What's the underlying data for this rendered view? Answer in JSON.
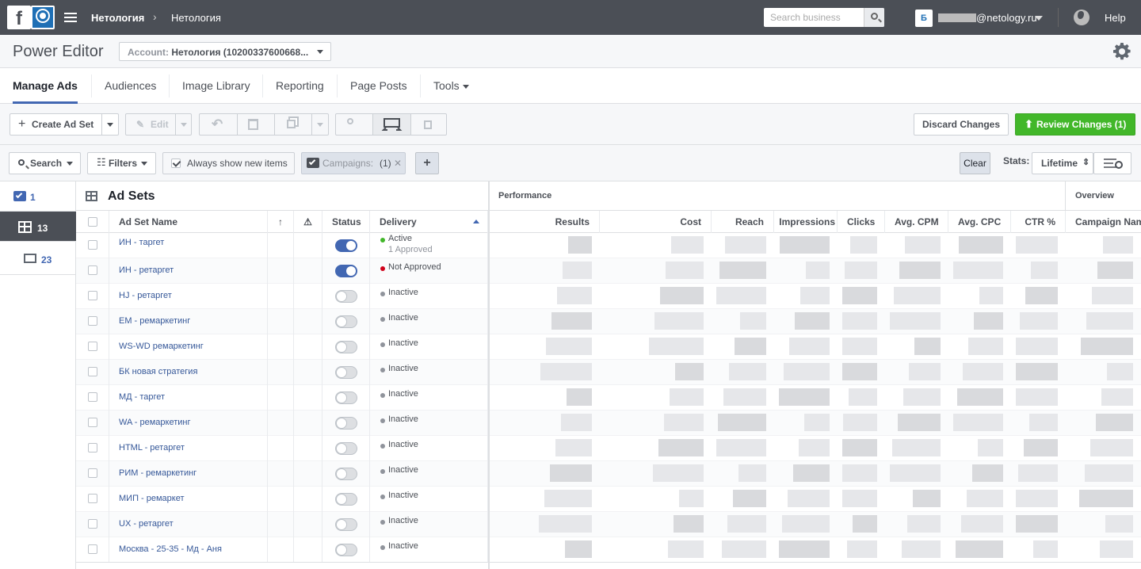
{
  "header": {
    "fb_logo_glyph": "f",
    "breadcrumb": [
      "Нетология",
      "Нетология"
    ],
    "search_placeholder": "Search business",
    "account_initial": "Б",
    "email": "@netology.ru",
    "help": "Help"
  },
  "title_bar": {
    "title": "Power Editor",
    "account_label": "Account:",
    "account_value": "Нетология (10200337600668..."
  },
  "tabs": [
    {
      "label": "Manage Ads",
      "active": true
    },
    {
      "label": "Audiences"
    },
    {
      "label": "Image Library"
    },
    {
      "label": "Reporting"
    },
    {
      "label": "Page Posts"
    },
    {
      "label": "Tools"
    }
  ],
  "toolbar": {
    "create_label": "Create Ad Set",
    "edit_label": "Edit",
    "discard_label": "Discard Changes",
    "review_label": "Review Changes (1)"
  },
  "filterbar": {
    "search_label": "Search",
    "filters_label": "Filters",
    "always_show_label": "Always show new items",
    "campaigns_label": "Campaigns:",
    "campaigns_count": "(1)",
    "clear_label": "Clear",
    "stats_label": "Stats:",
    "stats_value": "Lifetime"
  },
  "levels": [
    {
      "count": "1"
    },
    {
      "count": "13"
    },
    {
      "count": "23"
    }
  ],
  "grid": {
    "title": "Ad Sets",
    "performance_label": "Performance",
    "overview_label": "Overview",
    "columns": {
      "name": "Ad Set Name",
      "status": "Status",
      "delivery": "Delivery",
      "results": "Results",
      "cost": "Cost",
      "reach": "Reach",
      "impressions": "Impressions",
      "clicks": "Clicks",
      "avg_cpm": "Avg. CPM",
      "avg_cpc": "Avg. CPC",
      "ctr": "CTR %",
      "campaign_name": "Campaign Nam"
    },
    "rows": [
      {
        "name": "ИН - таргет",
        "on": true,
        "delivery": "Active",
        "sub": "1 Approved",
        "dot": "#42b72a"
      },
      {
        "name": "ИН - ретаргет",
        "on": true,
        "delivery": "Not Approved",
        "dot": "#d0021b"
      },
      {
        "name": "HJ - ретаргет",
        "on": false,
        "delivery": "Inactive",
        "dot": "#90949c"
      },
      {
        "name": "EM - ремаркетинг",
        "on": false,
        "delivery": "Inactive",
        "dot": "#90949c"
      },
      {
        "name": "WS-WD ремаркетинг",
        "on": false,
        "delivery": "Inactive",
        "dot": "#90949c"
      },
      {
        "name": "БК новая стратегия",
        "on": false,
        "delivery": "Inactive",
        "dot": "#90949c"
      },
      {
        "name": "МД - таргет",
        "on": false,
        "delivery": "Inactive",
        "dot": "#90949c"
      },
      {
        "name": "WA - ремаркетинг",
        "on": false,
        "delivery": "Inactive",
        "dot": "#90949c"
      },
      {
        "name": "HTML - ретаргет",
        "on": false,
        "delivery": "Inactive",
        "dot": "#90949c"
      },
      {
        "name": "РИМ - ремаркетинг",
        "on": false,
        "delivery": "Inactive",
        "dot": "#90949c"
      },
      {
        "name": "МИП - ремаркет",
        "on": false,
        "delivery": "Inactive",
        "dot": "#90949c"
      },
      {
        "name": "UX - ретаргет",
        "on": false,
        "delivery": "Inactive",
        "dot": "#90949c"
      },
      {
        "name": "Москва - 25-35 - Мд - Аня",
        "on": false,
        "delivery": "Inactive",
        "dot": "#90949c"
      }
    ]
  }
}
